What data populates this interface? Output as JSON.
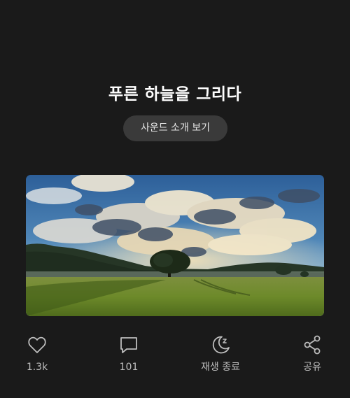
{
  "page": {
    "title": "푸른 하늘을 그리다",
    "sound_intro_label": "사운드 소개 보기"
  },
  "hero_image": {
    "description_icon": "landscape-image"
  },
  "actions": {
    "like": {
      "icon": "heart-icon",
      "label": "1.3k"
    },
    "comment": {
      "icon": "comment-icon",
      "label": "101"
    },
    "sleep_timer": {
      "icon": "moon-zzz-icon",
      "label": "재생 종료"
    },
    "share": {
      "icon": "share-icon",
      "label": "공유"
    }
  },
  "colors": {
    "background": "#1a1a1a",
    "button_bg": "#3a3a3a",
    "icon_stroke": "#bdbdbd"
  }
}
